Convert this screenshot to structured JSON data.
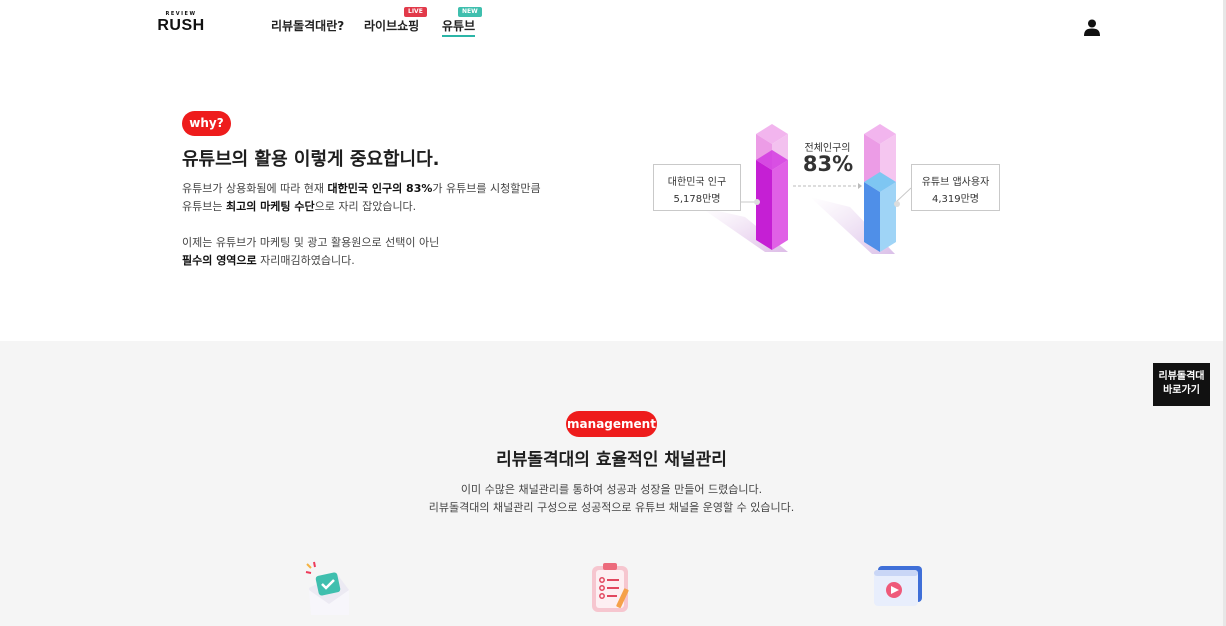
{
  "header": {
    "logo_small": "REVIEW",
    "logo_main": "RUSH",
    "nav": [
      {
        "label": "리뷰돌격대란?"
      },
      {
        "label": "라이브쇼핑",
        "badge": "LIVE"
      },
      {
        "label": "유튜브",
        "badge": "NEW"
      }
    ],
    "user_icon": "user-icon"
  },
  "why": {
    "pill": "why?",
    "heading": "유튜브의 활용 이렇게 중요합니다.",
    "line1": {
      "pre": "유튜브가 상용화됨에 따라 현재 ",
      "bold": "대한민국 인구의 83%",
      "post": "가 유튜브를 시청할만큼"
    },
    "line2": {
      "pre": "유튜브는 ",
      "bold": "최고의 마케팅 수단",
      "post": "으로 자리 잡았습니다."
    },
    "line3": "이제는 유튜브가 마케팅 및 광고 활용원으로 선택이 아닌",
    "line4": {
      "bold": "필수의 영역으로",
      "post": " 자리매김하였습니다."
    }
  },
  "infographic": {
    "korea_label": "대한민국 인구",
    "korea_value": "5,178만명",
    "youtube_label": "유튜브 앱사용자",
    "youtube_value": "4,319만명",
    "percent_label": "전체인구의",
    "percent_value": "83%",
    "youtube_share": 0.83,
    "colors": {
      "magenta": "#c61fd8",
      "blue": "#4f8fe8",
      "pink_light": "#f0a8ea"
    }
  },
  "management": {
    "pill": "management",
    "heading": "리뷰돌격대의 효율적인 채널관리",
    "desc1": "이미 수많은 채널관리를 통하여 성공과 성장을 만들어 드렸습니다.",
    "desc2": "리뷰돌격대의 채널관리 구성으로 성공적으로 유튜브 채널을 운영할 수 있습니다."
  },
  "quick_link": {
    "line1": "리뷰돌격대",
    "line2": "바로가기"
  },
  "colors": {
    "accent": "#ee1c1c",
    "teal": "#3fbfae",
    "dark": "#111111"
  }
}
